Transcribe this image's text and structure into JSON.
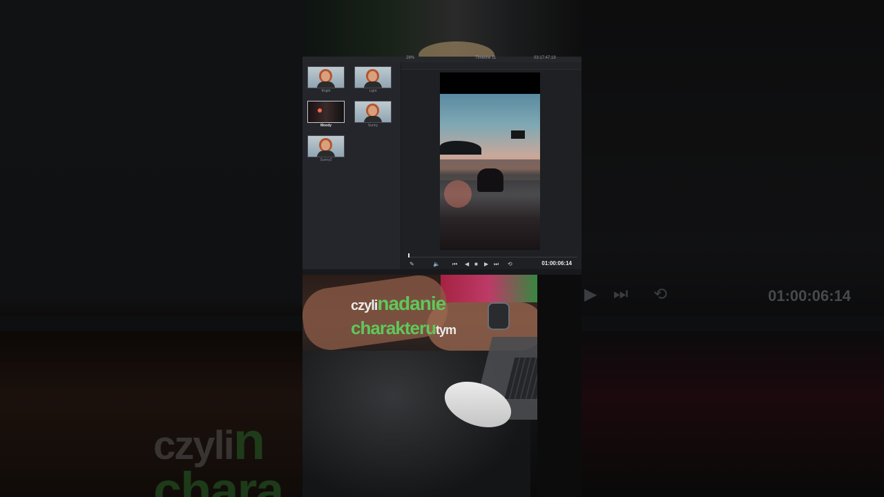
{
  "presets": [
    {
      "label": "Bright"
    },
    {
      "label": "Light"
    },
    {
      "label": "Moody"
    },
    {
      "label": "Sunny"
    },
    {
      "label": "Sunny2"
    }
  ],
  "viewer": {
    "timecode": "01:00:06:14",
    "zoom": "28%",
    "timeline_name": "Timeline 11",
    "source_timecode": "03:17:47:19"
  },
  "caption": {
    "line1_white": "czyli",
    "line1_green": "nadanie",
    "line2_green": "charakteru",
    "line2_white": "tym"
  },
  "background": {
    "timecode": "01:00:06:14",
    "text_white": "czyli",
    "text_green_partial": "n",
    "text_green_partial2": "chara"
  },
  "colors": {
    "accent_green": "#5fc85a",
    "panel_bg": "#1e1f23"
  }
}
